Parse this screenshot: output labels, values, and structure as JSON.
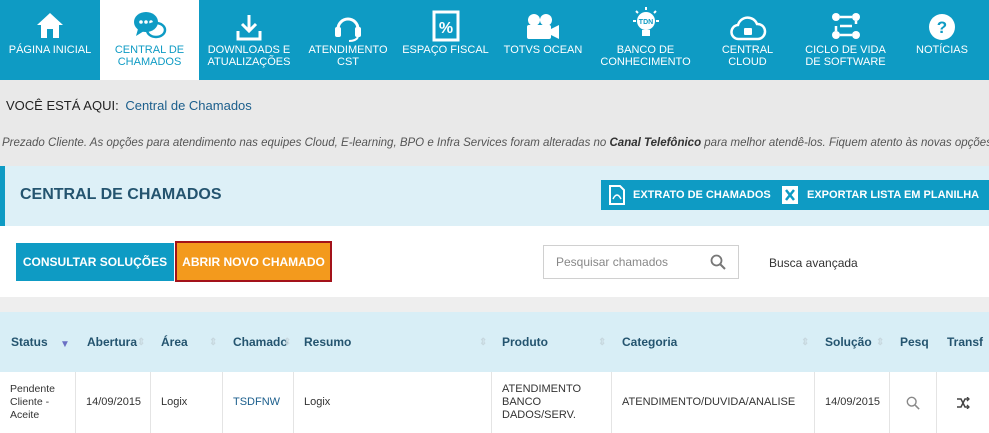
{
  "nav": [
    {
      "label": "PÁGINA INICIAL",
      "icon": "home-icon"
    },
    {
      "label": "CENTRAL DE CHAMADOS",
      "icon": "chat-bubbles-icon"
    },
    {
      "label": "DOWNLOADS E ATUALIZAÇÕES",
      "icon": "download-icon"
    },
    {
      "label": "ATENDIMENTO CST",
      "icon": "headset-icon"
    },
    {
      "label": "ESPAÇO FISCAL",
      "icon": "percent-doc-icon"
    },
    {
      "label": "TOTVS OCEAN",
      "icon": "camera-icon"
    },
    {
      "label": "BANCO DE CONHECIMENTO",
      "icon": "lightbulb-icon"
    },
    {
      "label": "CENTRAL CLOUD",
      "icon": "cloud-icon"
    },
    {
      "label": "CICLO DE VIDA DE SOFTWARE",
      "icon": "flow-icon"
    },
    {
      "label": "NOTÍCIAS",
      "icon": "question-icon"
    }
  ],
  "nav_bulb_text": "TDN",
  "breadcrumb": {
    "prefix": "VOCÊ ESTÁ AQUI:",
    "current": "Central de Chamados"
  },
  "notice": {
    "before": "Prezado Cliente. As opções para atendimento nas equipes Cloud, E-learning, BPO e Infra Services foram alteradas no ",
    "bold": "Canal Telefônico",
    "after": " para melhor atendê-los. Fiquem atento às novas opções."
  },
  "section": {
    "title": "CENTRAL DE CHAMADOS",
    "extract_btn": "EXTRATO DE CHAMADOS",
    "export_btn": "EXPORTAR LISTA EM PLANILHA"
  },
  "actions": {
    "consult": "CONSULTAR SOLUÇÕES",
    "open_new": "ABRIR NOVO CHAMADO",
    "search_placeholder": "Pesquisar chamados",
    "advanced": "Busca avançada"
  },
  "table": {
    "headers": [
      "Status",
      "Abertura",
      "Área",
      "Chamado",
      "Resumo",
      "Produto",
      "Categoria",
      "Solução",
      "Pesq",
      "Transf"
    ],
    "row": {
      "status": "Pendente Cliente - Aceite",
      "abertura": "14/09/2015",
      "area": "Logix",
      "chamado": "TSDFNW",
      "resumo": "Logix",
      "produto": "ATENDIMENTO BANCO DADOS/SERV.",
      "categoria": "ATENDIMENTO/DUVIDA/ANALISE",
      "solucao": "14/09/2015"
    }
  },
  "colors": {
    "primary": "#0e9bc4",
    "accent": "#f39a1d",
    "highlight_border": "#a3121a"
  }
}
